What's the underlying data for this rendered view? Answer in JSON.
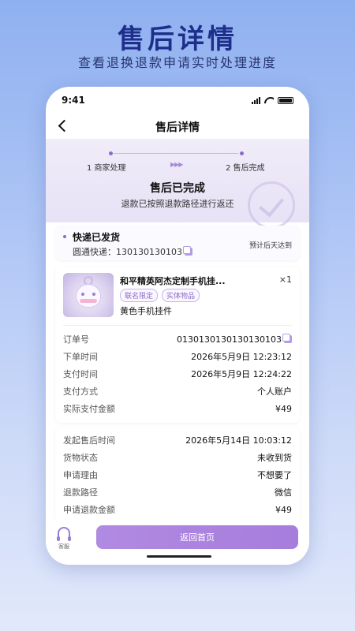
{
  "promo": {
    "title": "售后详情",
    "subtitle": "查看退换退款申请实时处理进度"
  },
  "status_bar": {
    "time": "9:41"
  },
  "nav": {
    "title": "售后详情"
  },
  "progress": {
    "step1": "1 商家处理",
    "step2": "2 售后完成",
    "arrows": "▶▶▶"
  },
  "hero": {
    "title": "售后已完成",
    "description": "退款已按照退款路径进行返还"
  },
  "express": {
    "title": "快递已发货",
    "carrier_line": "圆通快递：130130130103",
    "eta": "预计后天达到"
  },
  "product": {
    "name": "和平精英阿杰定制手机挂...",
    "quantity": "×1",
    "tags": [
      "联名限定",
      "实体物品"
    ],
    "variant": "黄色手机挂件"
  },
  "order_info": [
    {
      "key": "订单号",
      "value": "0130130130130130103",
      "copy": true
    },
    {
      "key": "下单时间",
      "value": "2026年5月9日  12:23:12"
    },
    {
      "key": "支付时间",
      "value": "2026年5月9日  12:24:22"
    },
    {
      "key": "支付方式",
      "value": "个人账户"
    },
    {
      "key": "实际支付金额",
      "value": "¥49"
    }
  ],
  "aftersale_info": [
    {
      "key": "发起售后时间",
      "value": "2026年5月14日  10:03:12"
    },
    {
      "key": "货物状态",
      "value": "未收到货"
    },
    {
      "key": "申请理由",
      "value": "不想要了"
    },
    {
      "key": "退款路径",
      "value": "微信"
    },
    {
      "key": "申请退款金额",
      "value": "¥49"
    }
  ],
  "bottom": {
    "service_label": "客服",
    "home_button": "返回首页"
  },
  "colors": {
    "accent": "#a67ddc",
    "title_blue": "#1d2f8a"
  }
}
